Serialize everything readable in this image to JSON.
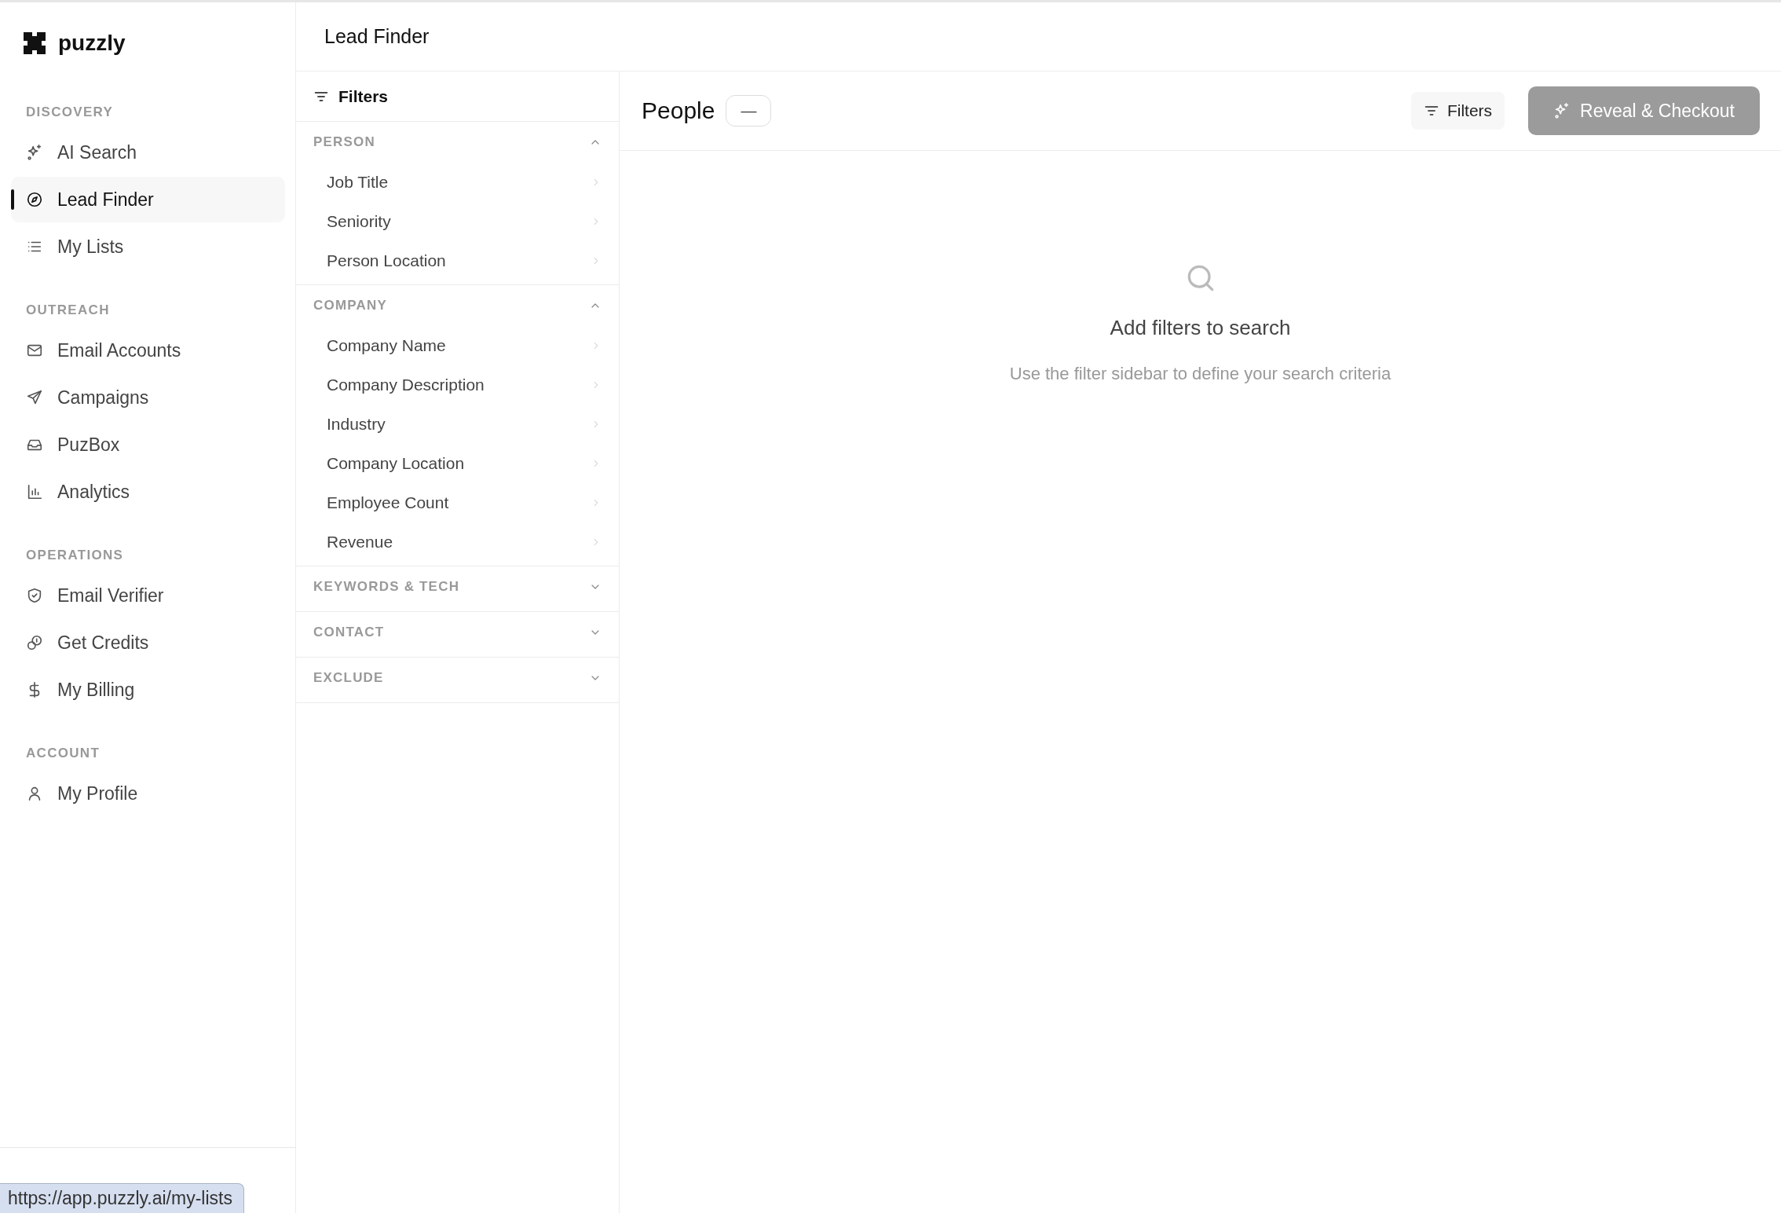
{
  "app": {
    "name": "puzzly"
  },
  "sidebar": {
    "groups": [
      {
        "label": "DISCOVERY",
        "items": [
          {
            "label": "AI Search",
            "selected": false
          },
          {
            "label": "Lead Finder",
            "selected": true
          },
          {
            "label": "My Lists",
            "selected": false
          }
        ]
      },
      {
        "label": "OUTREACH",
        "items": [
          {
            "label": "Email Accounts",
            "selected": false
          },
          {
            "label": "Campaigns",
            "selected": false
          },
          {
            "label": "PuzBox",
            "selected": false
          },
          {
            "label": "Analytics",
            "selected": false
          }
        ]
      },
      {
        "label": "OPERATIONS",
        "items": [
          {
            "label": "Email Verifier",
            "selected": false
          },
          {
            "label": "Get Credits",
            "selected": false
          },
          {
            "label": "My Billing",
            "selected": false
          }
        ]
      },
      {
        "label": "ACCOUNT",
        "items": [
          {
            "label": "My Profile",
            "selected": false
          }
        ]
      }
    ]
  },
  "page_title": "Lead Finder",
  "filters": {
    "title": "Filters",
    "sections": [
      {
        "label": "PERSON",
        "expanded": true,
        "items": [
          "Job Title",
          "Seniority",
          "Person Location"
        ]
      },
      {
        "label": "COMPANY",
        "expanded": true,
        "items": [
          "Company Name",
          "Company Description",
          "Industry",
          "Company Location",
          "Employee Count",
          "Revenue"
        ]
      },
      {
        "label": "KEYWORDS & TECH",
        "expanded": false
      },
      {
        "label": "CONTACT",
        "expanded": false
      },
      {
        "label": "EXCLUDE",
        "expanded": false
      }
    ]
  },
  "results": {
    "title": "People",
    "count_badge": "—",
    "filters_button": "Filters",
    "reveal_button": {
      "label": "Reveal & Checkout",
      "disabled": true
    },
    "empty_state": {
      "title": "Add filters to search",
      "subtitle": "Use the filter sidebar to define your search criteria"
    }
  },
  "status_bar": {
    "url": "https://app.puzzly.ai/my-lists"
  }
}
